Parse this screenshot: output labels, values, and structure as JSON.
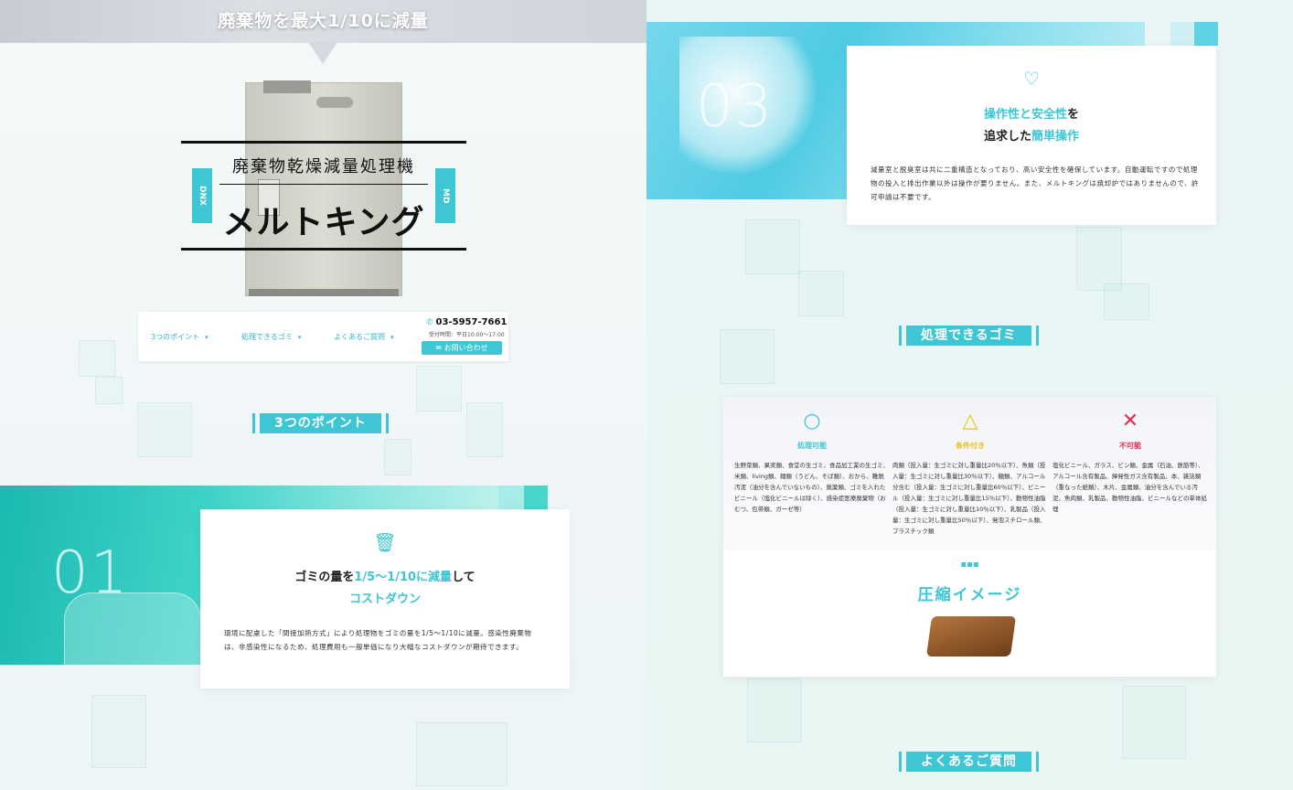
{
  "banner": {
    "text": "廃棄物を最大1/10に減量"
  },
  "hero": {
    "subtitle": "廃棄物乾燥減量処理機",
    "title": "メルトキング",
    "tag_left": "DNX",
    "tag_right": "MD"
  },
  "nav": {
    "items": [
      {
        "label": "3つのポイント"
      },
      {
        "label": "処理できるゴミ"
      },
      {
        "label": "よくあるご質問"
      }
    ],
    "phone": "03-5957-7661",
    "hours": "受付時間：平日10:00〜17:00",
    "contact_label": "お問い合わせ"
  },
  "sections": {
    "points": "3つのポイント",
    "garbage": "処理できるゴミ",
    "faq": "よくあるご質問"
  },
  "point01": {
    "number": "01",
    "icon": "trash-icon",
    "title_a": "ゴミの量を",
    "title_hl": "1/5〜1/10に減量",
    "title_b": "して",
    "title_line2": "コストダウン",
    "body": "環境に配慮した「間接加熱方式」により処理物をゴミの量を1/5〜1/10に減量。感染性廃棄物は、非感染性になるため、処理費用も一般単価になり大幅なコストダウンが期待できます。"
  },
  "point03": {
    "number": "03",
    "icon": "heart-check-icon",
    "title_hl1": "操作性と安全性",
    "title_a": "を",
    "title_b": "追求した",
    "title_hl2": "簡単操作",
    "body": "減量室と脱臭室は共に二重構造となっており、高い安全性を確保しています。自動運転ですので処理物の投入と排出作業以外は操作が要りません。また、メルトキングは焼却炉ではありませんので、許可申請は不要です。"
  },
  "garbage": {
    "columns": [
      {
        "symbol": "○",
        "label": "処理可能",
        "color": "#3ec6d5",
        "text": "生野菜類、果実類、食堂の生ゴミ、食品加工業の生ゴミ、米類、living類、麺類（うどん、そば類）、おから、難脱汚泥（油分を含んでいないもの）、廃薬類、ゴミを入れたビニール（塩化ビニールは除く）、感染症医療廃棄物（おむつ、包帯類、ガーゼ等）"
      },
      {
        "symbol": "△",
        "label": "条件付き",
        "color": "#e9c21a",
        "text": "肉類（投入量：生ゴミに対し重量比20％以下）、魚類（投入量：生ゴミに対し重量比30％以下）、糖類、アルコール分含む（投入量：生ゴミに対し重量比60％以下）、ビニール（投入量：生ゴミに対し重量比15％以下）、動物性油脂（投入量：生ゴミに対し重量比10％以下）、乳製品（投入量：生ゴミに対し重量比50％以下）、発泡スチロール類、プラスチック類"
      },
      {
        "symbol": "✕",
        "label": "不可能",
        "color": "#e2304f",
        "text": "塩化ビニール、ガラス、ビン類、金属（石油、鉄筋等）、アルコール含有製品、揮発性ガス含有製品、本、雑誌類（重なった紙類）、木片、金属類、油分を含んでいる汚泥、魚肉類、乳製品、動物性油脂、ビニールなどの単体処理"
      }
    ],
    "compress_title": "圧縮イメージ"
  }
}
